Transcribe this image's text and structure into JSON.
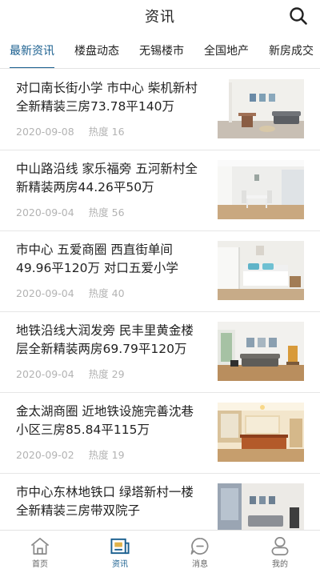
{
  "header": {
    "title": "资讯"
  },
  "tabs": [
    "最新资讯",
    "楼盘动态",
    "无锡楼市",
    "全国地产",
    "新房成交"
  ],
  "articles": [
    {
      "title": "对口南长街小学 市中心 柴机新村全新精装三房73.78平140万",
      "date": "2020-09-08",
      "heat_label": "热度",
      "heat": "16"
    },
    {
      "title": "中山路沿线 家乐福旁 五河新村全新精装两房44.26平50万",
      "date": "2020-09-04",
      "heat_label": "热度",
      "heat": "56"
    },
    {
      "title": " 市中心 五爱商圈 西直街单间49.96平120万 对口五爱小学",
      "date": "2020-09-04",
      "heat_label": "热度",
      "heat": "40"
    },
    {
      "title": "地铁沿线大润发旁 民丰里黄金楼层全新精装两房69.79平120万",
      "date": "2020-09-04",
      "heat_label": "热度",
      "heat": "29"
    },
    {
      "title": "金太湖商圈 近地铁设施完善沈巷小区三房85.84平115万",
      "date": "2020-09-02",
      "heat_label": "热度",
      "heat": "19"
    },
    {
      "title": "市中心东林地铁口 绿塔新村一楼全新精装三房带双院子",
      "date": "",
      "heat_label": "",
      "heat": ""
    }
  ],
  "tabbar": [
    {
      "label": "首页",
      "icon": "home-icon"
    },
    {
      "label": "资讯",
      "icon": "news-icon"
    },
    {
      "label": "消息",
      "icon": "message-icon"
    },
    {
      "label": "我的",
      "icon": "profile-icon"
    }
  ],
  "colors": {
    "accent": "#1a5f8f",
    "meta": "#b3b3b3",
    "divider": "#e6e6e6"
  }
}
